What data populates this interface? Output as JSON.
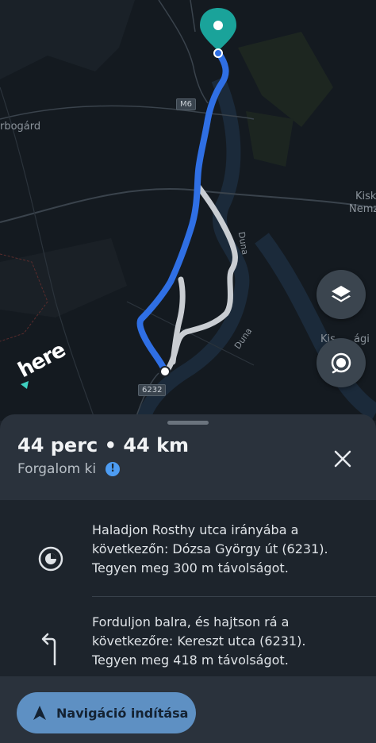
{
  "map": {
    "place_labels": [
      "rbogárd",
      "Kisk",
      "Nemz",
      "Kis",
      "ági"
    ],
    "river_labels": [
      "Duna",
      "Duna"
    ],
    "road_shields": [
      "M6",
      "6232"
    ],
    "colors": {
      "route_primary": "#2f6fe4",
      "route_alternative": "#c9cdd2",
      "destination_pin": "#1aa39a"
    }
  },
  "map_controls": {
    "layers_icon": "layers-icon",
    "recenter_icon": "recenter-icon"
  },
  "logo": {
    "text": "here"
  },
  "sheet": {
    "route_summary": "44 perc • 44 km",
    "traffic_label": "Forgalom ki",
    "info_icon": "!",
    "close_icon": "close-icon"
  },
  "steps": [
    {
      "icon": "start-position-icon",
      "text": "Haladjon Rosthy utca irányába a következőn: Dózsa György út (6231). Tegyen meg 300 m távolságot."
    },
    {
      "icon": "turn-left-icon",
      "text": "Forduljon balra, és hajtson rá a következőre: Kereszt utca (6231). Tegyen meg 418 m távolságot."
    }
  ],
  "start_button": {
    "label": "Navigáció indítása",
    "icon": "navigation-arrow-icon"
  }
}
